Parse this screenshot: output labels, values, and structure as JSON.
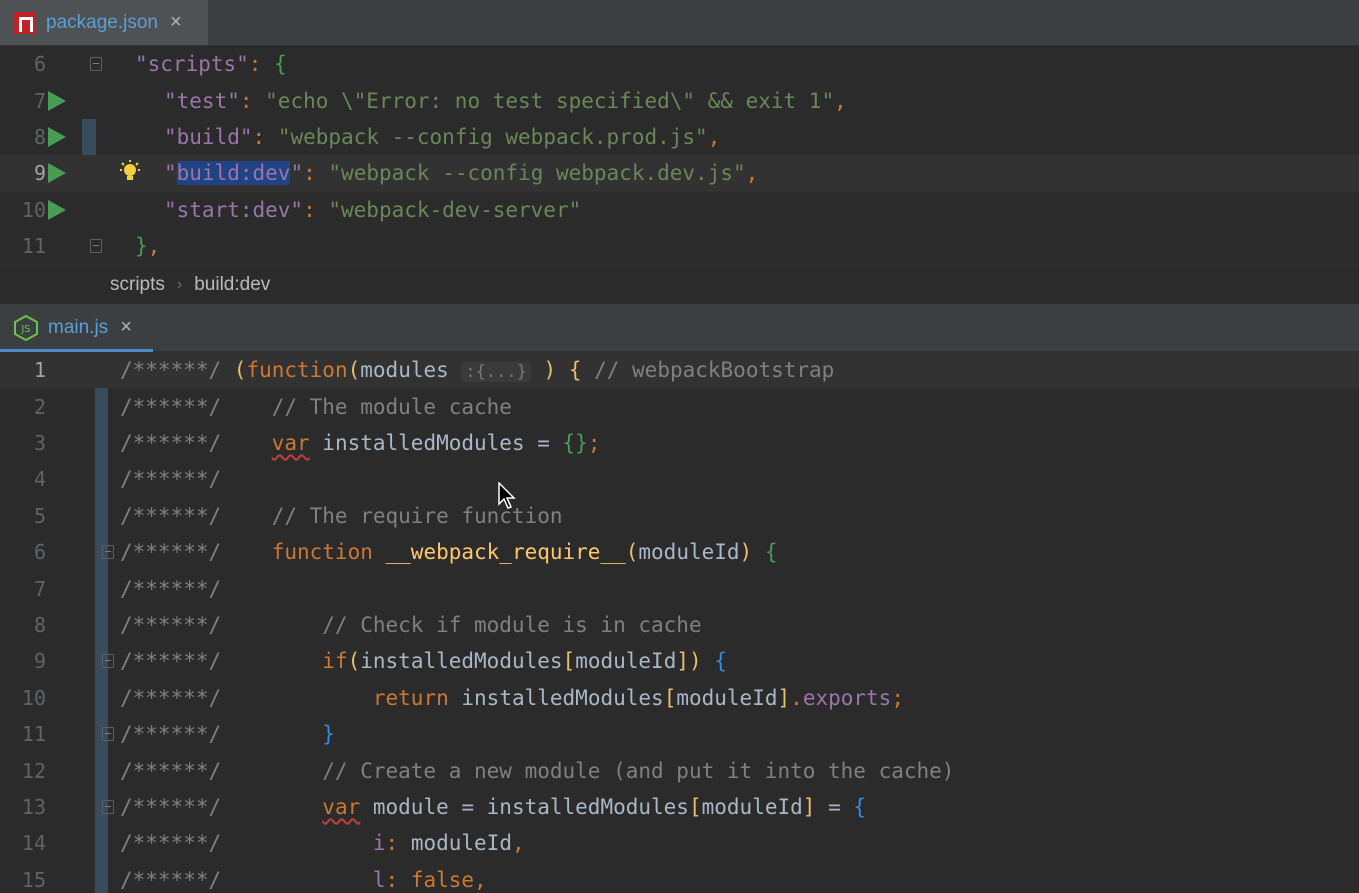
{
  "top_tab": {
    "label": "package.json",
    "close": "×",
    "icon": "npm-icon"
  },
  "bottom_tab": {
    "label": "main.js",
    "close": "×",
    "icon": "nodejs-icon"
  },
  "breadcrumb": {
    "items": [
      "scripts",
      "build:dev"
    ],
    "separator": "›"
  },
  "colors": {
    "accent": "#5c9fd6",
    "run": "#499c54",
    "selection": "#214283",
    "background": "#2b2b2b"
  },
  "package_json": {
    "lines": [
      {
        "num": "6",
        "parts": [
          [
            "s-key",
            "\"scripts\""
          ],
          [
            "s-pun",
            ": "
          ],
          [
            "s-brace-g",
            "{"
          ]
        ]
      },
      {
        "num": "7",
        "parts": [
          [
            "s-key",
            "\"test\""
          ],
          [
            "s-pun",
            ": "
          ],
          [
            "s-str",
            "\"echo \\\"Error: no test specified\\\" && exit 1\""
          ],
          [
            "s-pun",
            ","
          ]
        ]
      },
      {
        "num": "8",
        "parts": [
          [
            "s-key",
            "\"build\""
          ],
          [
            "s-pun",
            ": "
          ],
          [
            "s-str",
            "\"webpack --config webpack.prod.js\""
          ],
          [
            "s-pun",
            ","
          ]
        ]
      },
      {
        "num": "9",
        "parts": [
          [
            "s-key",
            "\""
          ],
          [
            "s-key sel",
            "build:dev"
          ],
          [
            "s-key",
            "\""
          ],
          [
            "s-pun",
            ": "
          ],
          [
            "s-str",
            "\"webpack --config webpack.dev.js\""
          ],
          [
            "s-pun",
            ","
          ]
        ]
      },
      {
        "num": "10",
        "parts": [
          [
            "s-key",
            "\"start:dev\""
          ],
          [
            "s-pun",
            ": "
          ],
          [
            "s-str",
            "\"webpack-dev-server\""
          ]
        ]
      },
      {
        "num": "11",
        "parts": [
          [
            "s-brace-g",
            "}"
          ],
          [
            "s-pun",
            ","
          ]
        ]
      }
    ]
  },
  "main_js": {
    "lines": [
      {
        "num": "1",
        "parts": [
          [
            "s-com",
            "/******/ "
          ],
          [
            "s-par",
            "("
          ],
          [
            "s-kw",
            "function"
          ],
          [
            "s-par",
            "("
          ],
          [
            "s-id",
            "modules "
          ],
          [
            "s-hint",
            ":{...}"
          ],
          [
            "s-id",
            " "
          ],
          [
            "s-par",
            ")"
          ],
          [
            "s-id",
            " "
          ],
          [
            "s-par",
            "{"
          ],
          [
            "s-com",
            " // webpackBootstrap"
          ]
        ]
      },
      {
        "num": "2",
        "parts": [
          [
            "s-com",
            "/******/    // The module cache"
          ]
        ]
      },
      {
        "num": "3",
        "parts": [
          [
            "s-com",
            "/******/    "
          ],
          [
            "s-kw squig",
            "var"
          ],
          [
            "s-id",
            " installedModules = "
          ],
          [
            "s-brace-g",
            "{}"
          ],
          [
            "s-pun",
            ";"
          ]
        ]
      },
      {
        "num": "4",
        "parts": [
          [
            "s-com",
            "/******/"
          ]
        ]
      },
      {
        "num": "5",
        "parts": [
          [
            "s-com",
            "/******/    // The require function"
          ]
        ]
      },
      {
        "num": "6",
        "parts": [
          [
            "s-com",
            "/******/    "
          ],
          [
            "s-kw",
            "function "
          ],
          [
            "s-fn",
            "__webpack_require__"
          ],
          [
            "s-par",
            "("
          ],
          [
            "s-id",
            "moduleId"
          ],
          [
            "s-par",
            ")"
          ],
          [
            "s-id",
            " "
          ],
          [
            "s-brace-g",
            "{"
          ]
        ]
      },
      {
        "num": "7",
        "parts": [
          [
            "s-com",
            "/******/"
          ]
        ]
      },
      {
        "num": "8",
        "parts": [
          [
            "s-com",
            "/******/        // Check if module is in cache"
          ]
        ]
      },
      {
        "num": "9",
        "parts": [
          [
            "s-com",
            "/******/        "
          ],
          [
            "s-kw",
            "if"
          ],
          [
            "s-par",
            "("
          ],
          [
            "s-id",
            "installedModules"
          ],
          [
            "s-par",
            "["
          ],
          [
            "s-id",
            "moduleId"
          ],
          [
            "s-par",
            "])"
          ],
          [
            "s-id",
            " "
          ],
          [
            "s-brace-b",
            "{"
          ]
        ]
      },
      {
        "num": "10",
        "parts": [
          [
            "s-com",
            "/******/            "
          ],
          [
            "s-kw",
            "return "
          ],
          [
            "s-id",
            "installedModules"
          ],
          [
            "s-par",
            "["
          ],
          [
            "s-id",
            "moduleId"
          ],
          [
            "s-par",
            "]"
          ],
          [
            "s-pun",
            "."
          ],
          [
            "s-prop",
            "exports"
          ],
          [
            "s-pun",
            ";"
          ]
        ]
      },
      {
        "num": "11",
        "parts": [
          [
            "s-com",
            "/******/        "
          ],
          [
            "s-brace-b",
            "}"
          ]
        ]
      },
      {
        "num": "12",
        "parts": [
          [
            "s-com",
            "/******/        // Create a new module (and put it into the cache)"
          ]
        ]
      },
      {
        "num": "13",
        "parts": [
          [
            "s-com",
            "/******/        "
          ],
          [
            "s-kw squig",
            "var"
          ],
          [
            "s-id",
            " module = installedModules"
          ],
          [
            "s-par",
            "["
          ],
          [
            "s-id",
            "moduleId"
          ],
          [
            "s-par",
            "]"
          ],
          [
            "s-id",
            " = "
          ],
          [
            "s-brace-b",
            "{"
          ]
        ]
      },
      {
        "num": "14",
        "parts": [
          [
            "s-com",
            "/******/            "
          ],
          [
            "s-prop",
            "i"
          ],
          [
            "s-pun",
            ": "
          ],
          [
            "s-id",
            "moduleId"
          ],
          [
            "s-pun",
            ","
          ]
        ]
      },
      {
        "num": "15",
        "parts": [
          [
            "s-com",
            "/******/            "
          ],
          [
            "s-prop",
            "l"
          ],
          [
            "s-pun",
            ": "
          ],
          [
            "s-kw",
            "false"
          ],
          [
            "s-pun",
            ","
          ]
        ]
      }
    ]
  }
}
